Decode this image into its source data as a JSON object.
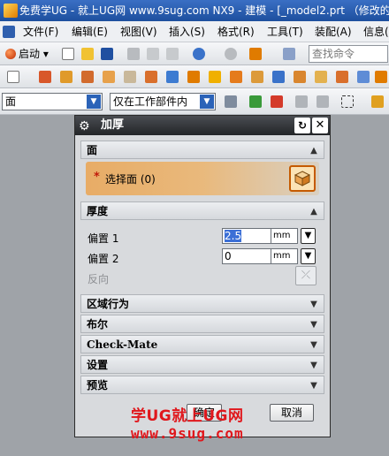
{
  "window": {
    "title": "免费学UG - 就上UG网 www.9sug.com   NX9 - 建模 - [_model2.prt （修改的"
  },
  "menubar": {
    "items": [
      "文件(F)",
      "编辑(E)",
      "视图(V)",
      "插入(S)",
      "格式(R)",
      "工具(T)",
      "装配(A)",
      "信息("
    ]
  },
  "toolbar": {
    "start_label": "启动",
    "search_placeholder": "查找命令"
  },
  "selection_bar": {
    "filter_value": "面",
    "scope_value": "仅在工作部件内"
  },
  "dialog": {
    "title": "加厚",
    "sections": {
      "face": "面",
      "thickness": "厚度",
      "region_behavior": "区域行为",
      "boolean": "布尔",
      "check_mate": "Check-Mate",
      "settings": "设置",
      "preview": "预览"
    },
    "face_select": {
      "required_mark": "*",
      "label": "选择面 (0)"
    },
    "offset1": {
      "label": "偏置 1",
      "value": "2.5",
      "unit": "mm"
    },
    "offset2": {
      "label": "偏置 2",
      "value": "0",
      "unit": "mm"
    },
    "reverse": {
      "label": "反向"
    },
    "buttons": {
      "ok": "确定",
      "cancel": "取消"
    }
  },
  "watermark": {
    "line1": "学UG就上UG网",
    "line2": "www.9sug.com"
  },
  "colors": {
    "title_bar": "#1d4f9e",
    "dialog_title": "#232528",
    "selection_orange": "#e8ac66",
    "watermark_red": "#e0171c"
  }
}
